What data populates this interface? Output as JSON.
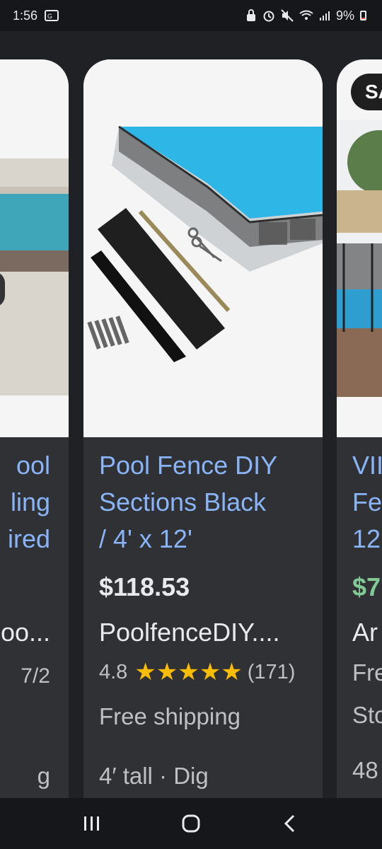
{
  "status_bar": {
    "time": "1:56",
    "battery": "9%"
  },
  "cards": {
    "left": {
      "title_lines": [
        "ool",
        "ling",
        "ired"
      ],
      "seller": "oo...",
      "rating_fragment": "7/2",
      "attr_fragment": "g"
    },
    "center": {
      "title_lines": [
        "Pool Fence DIY",
        "Sections Black",
        "/ 4' x 12'"
      ],
      "price": "$118.53",
      "seller": "PoolfenceDIY....",
      "rating": "4.8",
      "stars": 5,
      "review_count": "(171)",
      "shipping": "Free shipping",
      "attribute": "4′ tall · Dig"
    },
    "right": {
      "badge": "SA",
      "title_lines": [
        "VII",
        "Fe",
        "12l"
      ],
      "price": "$7",
      "seller": "Ar",
      "shipping": "Fre",
      "stock": "Sto",
      "attr_fragment": "48"
    }
  },
  "colors": {
    "link_title": "#8ab4f8",
    "star": "#fbbc04",
    "sale_price": "#81c995",
    "card_bg": "#303134",
    "page_bg": "#202124"
  }
}
